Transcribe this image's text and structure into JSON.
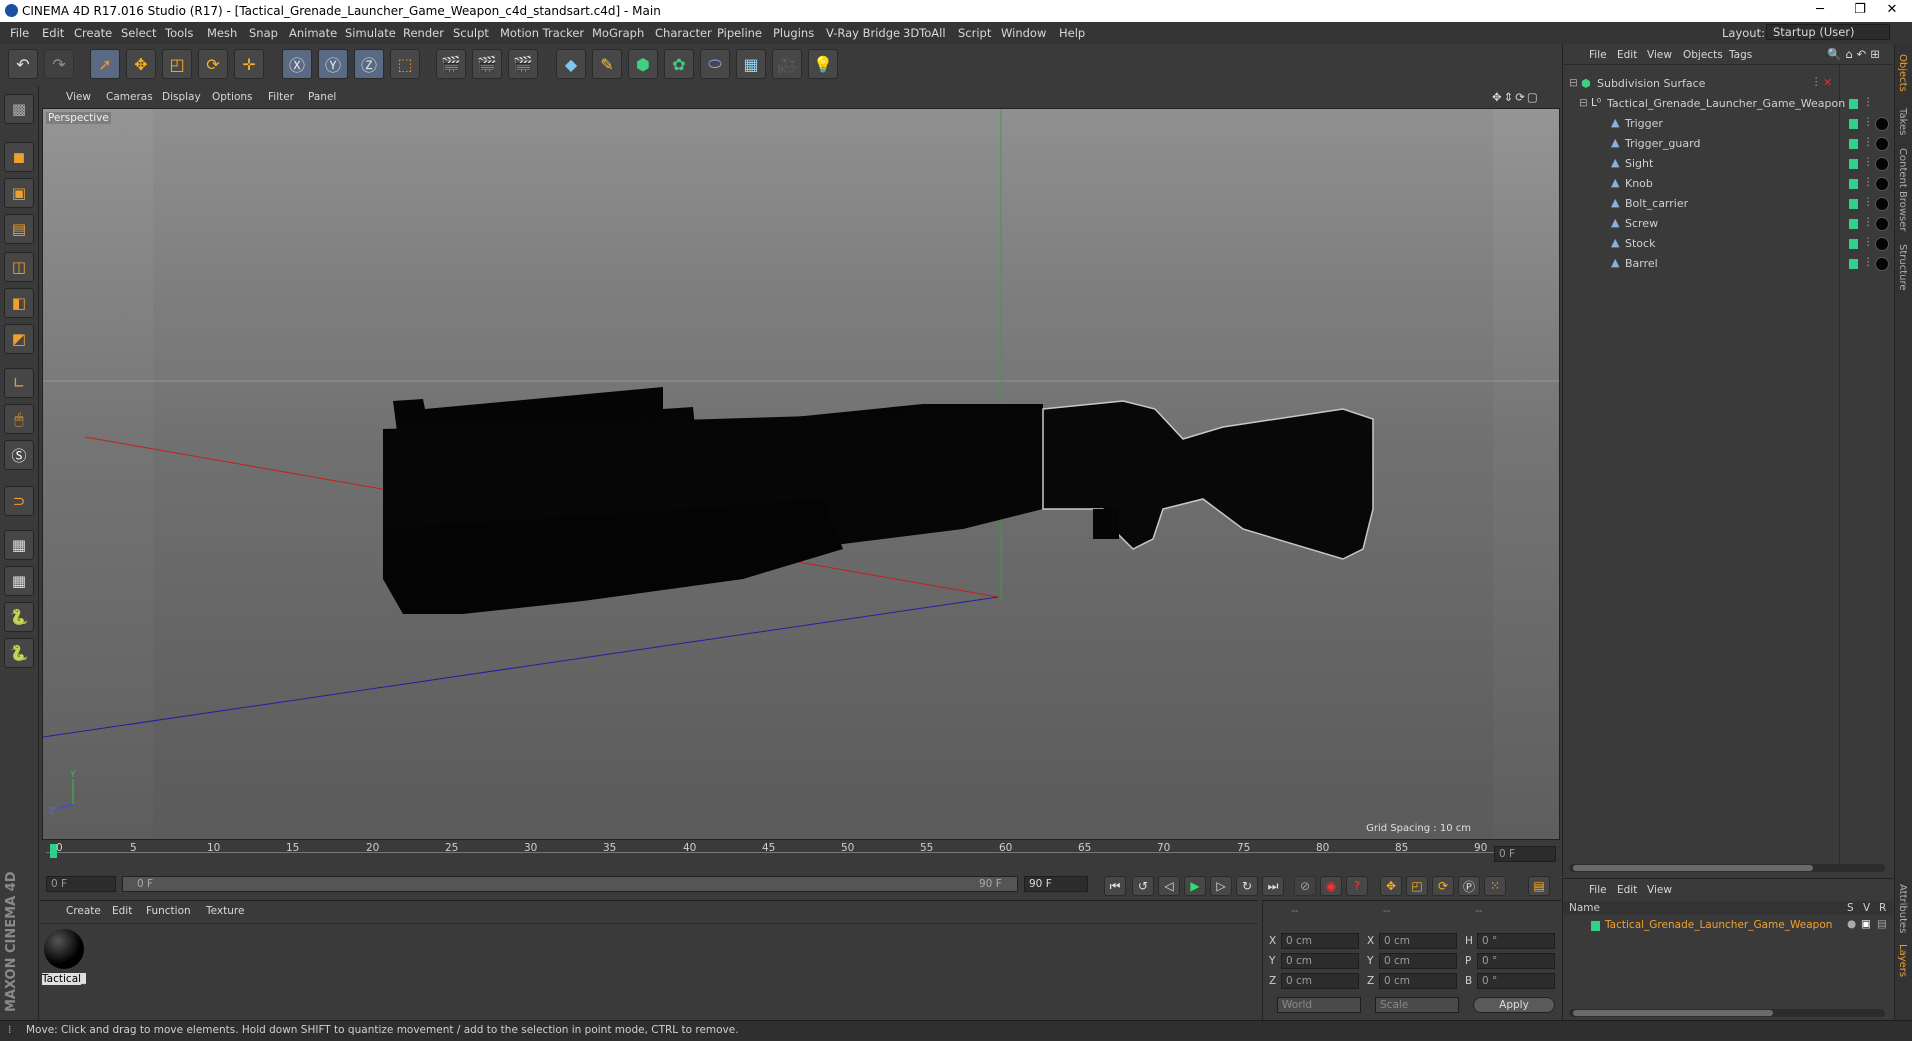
{
  "window": {
    "title": "CINEMA 4D R17.016 Studio (R17) - [Tactical_Grenade_Launcher_Game_Weapon_c4d_standsart.c4d] - Main",
    "minimize": "─",
    "restore": "❐",
    "close": "✕"
  },
  "menu": [
    "File",
    "Edit",
    "Create",
    "Select",
    "Tools",
    "Mesh",
    "Snap",
    "Animate",
    "Simulate",
    "Render",
    "Sculpt",
    "Motion Tracker",
    "MoGraph",
    "Character",
    "Pipeline",
    "Plugins",
    "V-Ray Bridge",
    "3DToAll",
    "Script",
    "Window",
    "Help"
  ],
  "layout": {
    "label": "Layout:",
    "value": "Startup (User)"
  },
  "viewport": {
    "menu": [
      "View",
      "Cameras",
      "Display",
      "Options",
      "Filter",
      "Panel"
    ],
    "camera_label": "Perspective",
    "grid_spacing": "Grid Spacing : 10 cm",
    "axis_y": "Y",
    "axis_z": "Z"
  },
  "timeline": {
    "ticks": [
      "0",
      "5",
      "10",
      "15",
      "20",
      "25",
      "30",
      "35",
      "40",
      "45",
      "50",
      "55",
      "60",
      "65",
      "70",
      "75",
      "80",
      "85",
      "90"
    ],
    "current_frame": "0 F",
    "start_field": "0 F",
    "slider_start": "0 F",
    "slider_end": "90 F",
    "end_field": "90 F"
  },
  "material_manager": {
    "menu": [
      "Create",
      "Edit",
      "Function",
      "Texture"
    ],
    "materials": [
      {
        "name": "Tactical_"
      }
    ]
  },
  "coordinates": {
    "headers": [
      "--",
      "--",
      "--"
    ],
    "rows": [
      {
        "a": "X",
        "av": "0 cm",
        "b": "X",
        "bv": "0 cm",
        "c": "H",
        "cv": "0 °"
      },
      {
        "a": "Y",
        "av": "0 cm",
        "b": "Y",
        "bv": "0 cm",
        "c": "P",
        "cv": "0 °"
      },
      {
        "a": "Z",
        "av": "0 cm",
        "b": "Z",
        "bv": "0 cm",
        "c": "B",
        "cv": "0 °"
      }
    ],
    "mode": "World",
    "type": "Scale",
    "apply": "Apply"
  },
  "object_manager": {
    "menu": [
      "File",
      "Edit",
      "View",
      "Objects",
      "Tags"
    ],
    "root": "Subdivision Surface",
    "group": "Tactical_Grenade_Launcher_Game_Weapon",
    "children": [
      "Trigger",
      "Trigger_guard",
      "Sight",
      "Knob",
      "Bolt_carrier",
      "Screw",
      "Stock",
      "Barrel"
    ]
  },
  "layer_manager": {
    "menu": [
      "File",
      "Edit",
      "View"
    ],
    "columns": {
      "name": "Name",
      "s": "S",
      "v": "V",
      "r": "R"
    },
    "layers": [
      "Tactical_Grenade_Launcher_Game_Weapon"
    ]
  },
  "right_tabs": [
    "Objects",
    "Takes",
    "Content Browser",
    "Structure"
  ],
  "right_tabs_lower": [
    "Attributes",
    "Layers"
  ],
  "brand": "MAXON CINEMA 4D",
  "status": "Move: Click and drag to move elements. Hold down SHIFT to quantize movement / add to the selection in point mode, CTRL to remove.",
  "colors": {
    "accent_green": "#2fd08a",
    "layer_orange": "#f0a030",
    "selection_blue": "#5a6a85"
  }
}
